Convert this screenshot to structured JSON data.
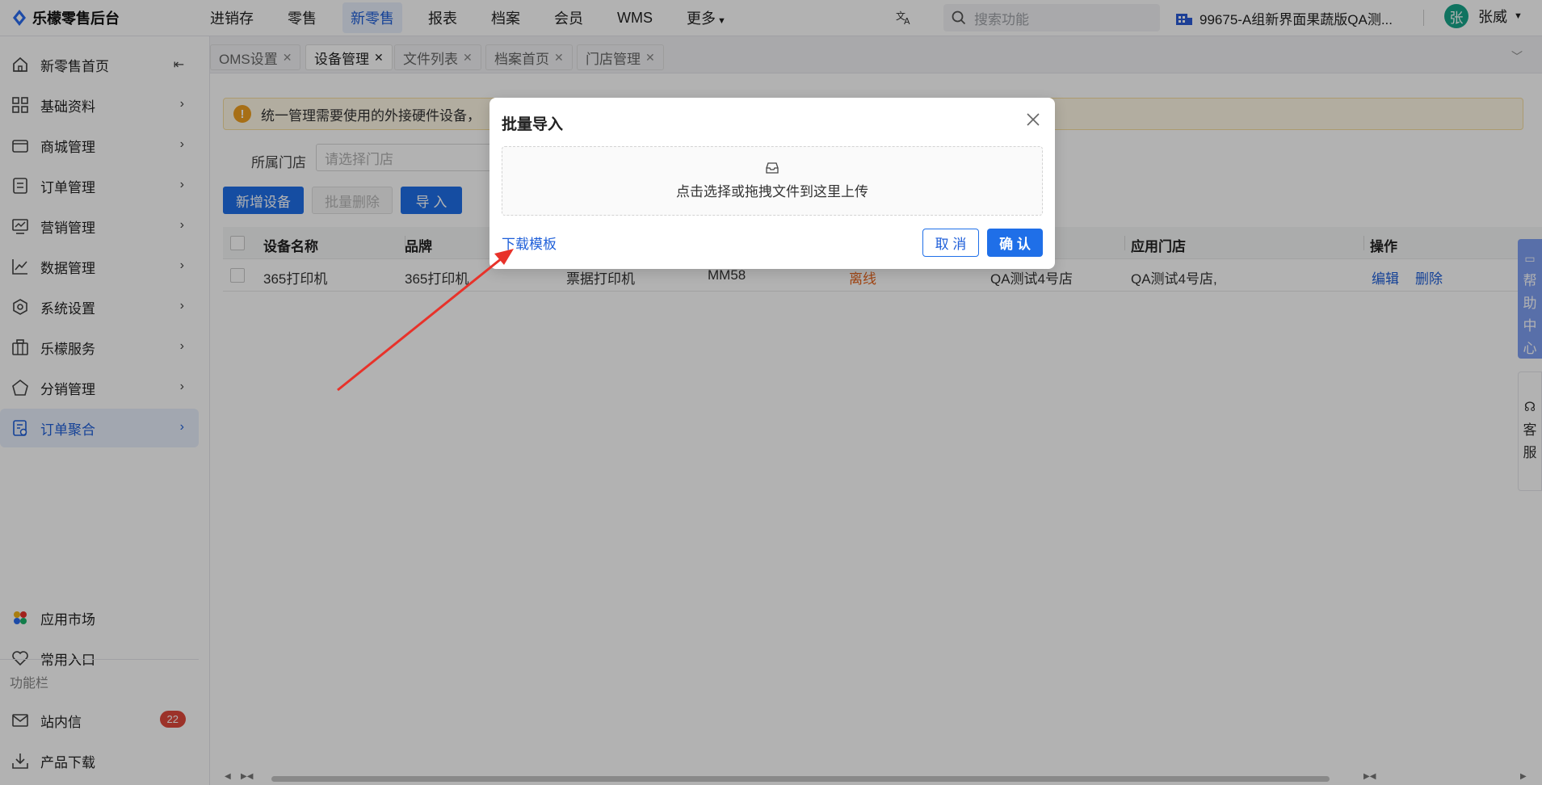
{
  "app": {
    "title": "乐檬零售后台"
  },
  "topnav": {
    "items": [
      {
        "label": "进销存"
      },
      {
        "label": "零售"
      },
      {
        "label": "新零售",
        "active": true
      },
      {
        "label": "报表"
      },
      {
        "label": "档案"
      },
      {
        "label": "会员"
      },
      {
        "label": "WMS"
      },
      {
        "label": "更多"
      }
    ],
    "search_placeholder": "搜索功能",
    "store_name": "99675-A组新界面果蔬版QA测...",
    "user_avatar": "张",
    "user_name": "张威"
  },
  "sidebar": {
    "items": [
      {
        "label": "新零售首页",
        "icon": "home-icon"
      },
      {
        "label": "基础资料",
        "icon": "grid-icon"
      },
      {
        "label": "商城管理",
        "icon": "shop-icon"
      },
      {
        "label": "订单管理",
        "icon": "order-icon"
      },
      {
        "label": "营销管理",
        "icon": "marketing-icon"
      },
      {
        "label": "数据管理",
        "icon": "chart-icon"
      },
      {
        "label": "系统设置",
        "icon": "settings-icon"
      },
      {
        "label": "乐檬服务",
        "icon": "briefcase-icon"
      },
      {
        "label": "分销管理",
        "icon": "distribution-icon"
      },
      {
        "label": "订单聚合",
        "icon": "order-aggregate-icon",
        "active": true
      }
    ],
    "bottom": {
      "app_market": "应用市场",
      "common_entry": "常用入口",
      "section_label": "功能栏",
      "messages": "站内信",
      "messages_count": "22",
      "downloads": "产品下载"
    }
  },
  "tabs": [
    {
      "label": "OMS设置"
    },
    {
      "label": "设备管理",
      "active": true
    },
    {
      "label": "文件列表"
    },
    {
      "label": "档案首页"
    },
    {
      "label": "门店管理"
    }
  ],
  "page": {
    "alert": "统一管理需要使用的外接硬件设备，",
    "filter_label": "所属门店",
    "filter_placeholder": "请选择门店",
    "buttons": {
      "add": "新增设备",
      "batch_delete": "批量删除",
      "import": "导 入"
    },
    "table": {
      "headers": [
        "设备名称",
        "品牌",
        "",
        "",
        "",
        "",
        "应用门店",
        "操作"
      ],
      "rows": [
        {
          "name": "365打印机",
          "brand": "365打印机",
          "type": "票据打印机",
          "model": "MM58",
          "status": "离线",
          "store": "QA测试4号店",
          "applied_store": "QA测试4号店,",
          "edit": "编辑",
          "delete": "删除"
        }
      ]
    }
  },
  "floating": {
    "help": [
      "帮",
      "助",
      "中",
      "心"
    ],
    "service": [
      "客",
      "服"
    ]
  },
  "modal": {
    "title": "批量导入",
    "upload_text": "点击选择或拖拽文件到这里上传",
    "download_template": "下载模板",
    "cancel": "取 消",
    "confirm": "确 认"
  },
  "colors": {
    "primary": "#1f6fe8",
    "offline": "#e6631c",
    "annotation_arrow": "#e8322a"
  }
}
